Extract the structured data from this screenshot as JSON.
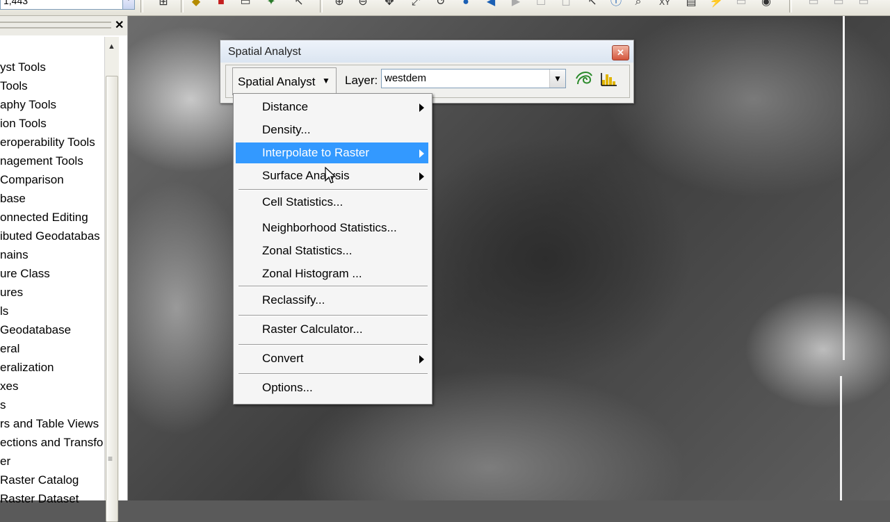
{
  "toolbar": {
    "coord_value": "1,443",
    "icons": [
      "add-data-icon",
      "layer-icon",
      "toolbox-icon",
      "window-icon",
      "python-icon",
      "select-icon",
      "zoom-in-icon",
      "zoom-out-icon",
      "pan-icon",
      "full-extent-icon",
      "globe-icon",
      "back-icon",
      "forward-icon",
      "select-features-icon",
      "info-icon",
      "xy-icon",
      "measure-icon",
      "hyperlink-icon",
      "find-icon"
    ],
    "xy_label": "XY"
  },
  "left_panel": {
    "items": [
      "yst Tools",
      " Tools",
      "aphy Tools",
      "ion Tools",
      "eroperability Tools",
      "nagement Tools",
      " Comparison",
      "base",
      "onnected Editing",
      "ibuted Geodatabas",
      "nains",
      "ure Class",
      "ures",
      "ls",
      "Geodatabase",
      "eral",
      "eralization",
      "xes",
      "s",
      "rs and Table Views",
      "ections and Transfo",
      "er",
      "Raster Catalog",
      "Raster Dataset"
    ]
  },
  "spatial_analyst": {
    "title": "Spatial Analyst",
    "menu_button": "Spatial Analyst",
    "layer_label": "Layer:",
    "layer_value": "westdem"
  },
  "menu": {
    "items": [
      {
        "label": "Distance",
        "submenu": true
      },
      {
        "label": "Density...",
        "submenu": false
      },
      {
        "label": "Interpolate to Raster",
        "submenu": true,
        "highlighted": true
      },
      {
        "label": "Surface Analysis",
        "submenu": true
      },
      {
        "label": "Cell Statistics...",
        "submenu": false
      },
      {
        "label": "Neighborhood Statistics...",
        "submenu": false
      },
      {
        "label": "Zonal Statistics...",
        "submenu": false
      },
      {
        "label": "Zonal Histogram ...",
        "submenu": false
      },
      {
        "label": "Reclassify...",
        "submenu": false
      },
      {
        "label": "Raster Calculator...",
        "submenu": false
      },
      {
        "label": "Convert",
        "submenu": true
      },
      {
        "label": "Options...",
        "submenu": false
      }
    ]
  },
  "colors": {
    "highlight": "#3399ff",
    "close_button": "#d4553c"
  }
}
